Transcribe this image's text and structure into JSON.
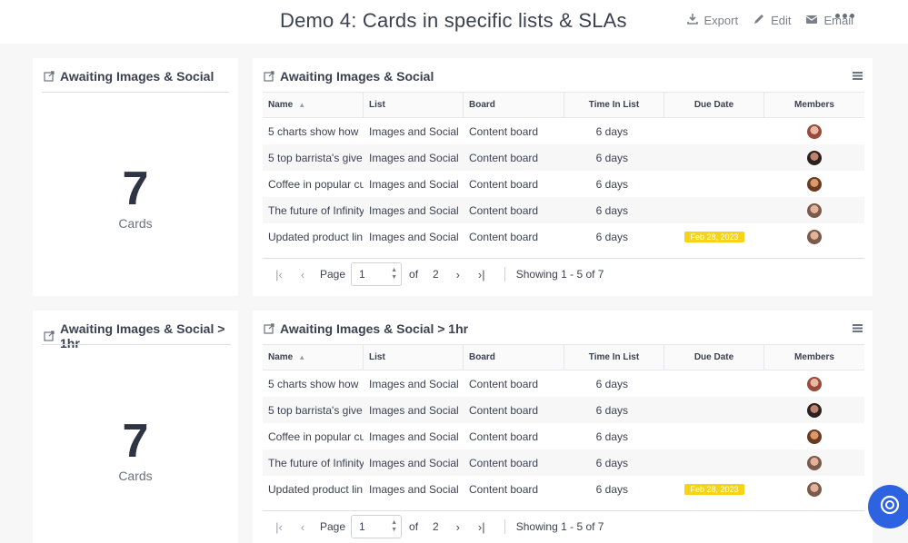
{
  "header": {
    "title": "Demo 4: Cards in specific lists & SLAs",
    "export_label": "Export",
    "edit_label": "Edit",
    "email_label": "Email"
  },
  "columns": {
    "name": "Name",
    "list": "List",
    "board": "Board",
    "time": "Time In List",
    "due": "Due Date",
    "members": "Members"
  },
  "sections": [
    {
      "metric_title": "Awaiting Images & Social",
      "metric_value": "7",
      "metric_label": "Cards",
      "table_title": "Awaiting Images & Social",
      "rows": [
        {
          "name": "5 charts show how",
          "list": "Images and Social",
          "board": "Content board",
          "time": "6 days",
          "due": ""
        },
        {
          "name": "5 top barrista's give",
          "list": "Images and Social",
          "board": "Content board",
          "time": "6 days",
          "due": ""
        },
        {
          "name": "Coffee in popular cu",
          "list": "Images and Social",
          "board": "Content board",
          "time": "6 days",
          "due": ""
        },
        {
          "name": "The future of Infinity",
          "list": "Images and Social",
          "board": "Content board",
          "time": "6 days",
          "due": ""
        },
        {
          "name": "Updated product lin",
          "list": "Images and Social",
          "board": "Content board",
          "time": "6 days",
          "due": "Feb 28, 2023"
        }
      ],
      "pager": {
        "page_label": "Page",
        "page_value": "1",
        "of_label": "of",
        "total_pages": "2",
        "showing": "Showing 1 - 5 of 7"
      }
    },
    {
      "metric_title": "Awaiting Images & Social > 1hr",
      "metric_value": "7",
      "metric_label": "Cards",
      "table_title": "Awaiting Images & Social > 1hr",
      "rows": [
        {
          "name": "5 charts show how",
          "list": "Images and Social",
          "board": "Content board",
          "time": "6 days",
          "due": ""
        },
        {
          "name": "5 top barrista's give",
          "list": "Images and Social",
          "board": "Content board",
          "time": "6 days",
          "due": ""
        },
        {
          "name": "Coffee in popular cu",
          "list": "Images and Social",
          "board": "Content board",
          "time": "6 days",
          "due": ""
        },
        {
          "name": "The future of Infinity",
          "list": "Images and Social",
          "board": "Content board",
          "time": "6 days",
          "due": ""
        },
        {
          "name": "Updated product lin",
          "list": "Images and Social",
          "board": "Content board",
          "time": "6 days",
          "due": "Feb 28, 2023"
        }
      ],
      "pager": {
        "page_label": "Page",
        "page_value": "1",
        "of_label": "of",
        "total_pages": "2",
        "showing": "Showing 1 - 5 of 7"
      }
    }
  ],
  "colors": {
    "accent": "#2d63e0",
    "due_badge": "#f6d316"
  },
  "icons": [
    "export-icon",
    "edit-icon",
    "email-icon",
    "more-icon",
    "external-link-icon",
    "list-view-icon",
    "help-icon"
  ]
}
